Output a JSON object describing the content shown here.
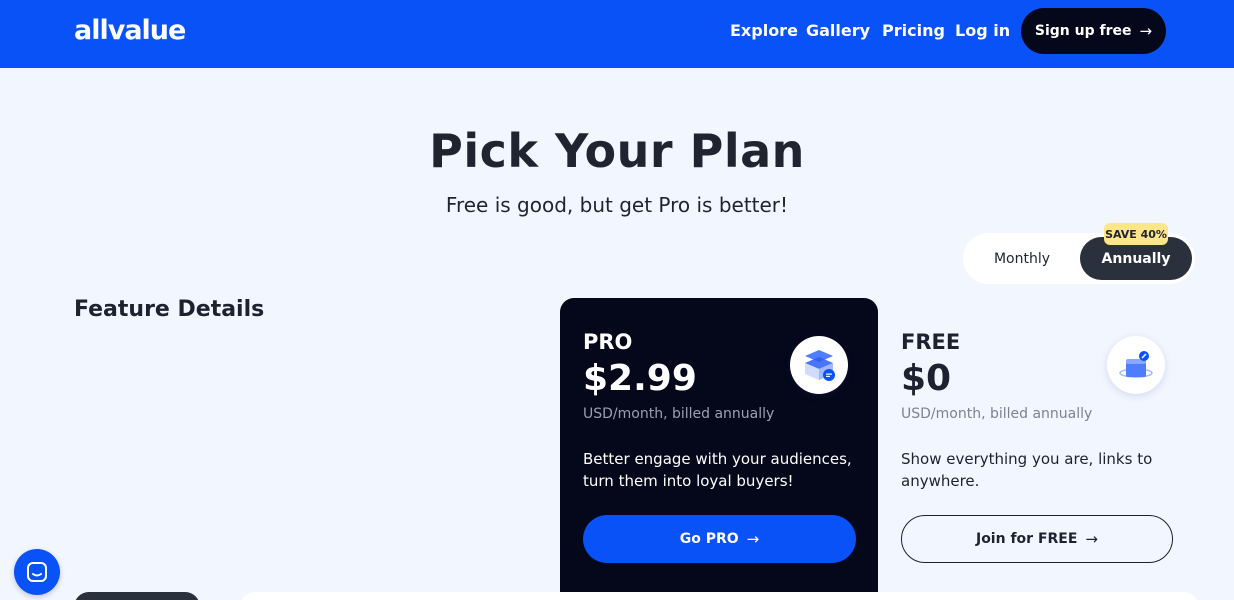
{
  "header": {
    "logo": "allvalue",
    "nav": [
      "Explore",
      "Gallery",
      "Pricing",
      "Log in"
    ],
    "signup_label": "Sign up free"
  },
  "hero": {
    "title": "Pick Your Plan",
    "subtitle": "Free is good, but get Pro is better!"
  },
  "toggle": {
    "monthly": "Monthly",
    "annually": "Annually",
    "selected": "Annually",
    "badge": "SAVE 40%"
  },
  "features": {
    "title": "Feature Details"
  },
  "plans": {
    "pro": {
      "name": "PRO",
      "price": "$2.99",
      "billing": "USD/month, billed annually",
      "description": "Better engage with your audiences, turn them into loyal buyers!",
      "cta": "Go PRO"
    },
    "free": {
      "name": "FREE",
      "price": "$0",
      "billing": "USD/month, billed annually",
      "description": "Show everything you are, links to anywhere.",
      "cta": "Join for FREE"
    }
  },
  "icons": {
    "cta_arrow": "arrow-right-icon",
    "pro_icon": "stacked-cube-icon",
    "free_icon": "box-link-icon",
    "chat": "chat-icon"
  },
  "colors": {
    "brand_blue": "#0852f7",
    "dark_navy": "#05081a",
    "page_bg": "#f2f6ff",
    "badge_yellow": "#fde58a"
  }
}
